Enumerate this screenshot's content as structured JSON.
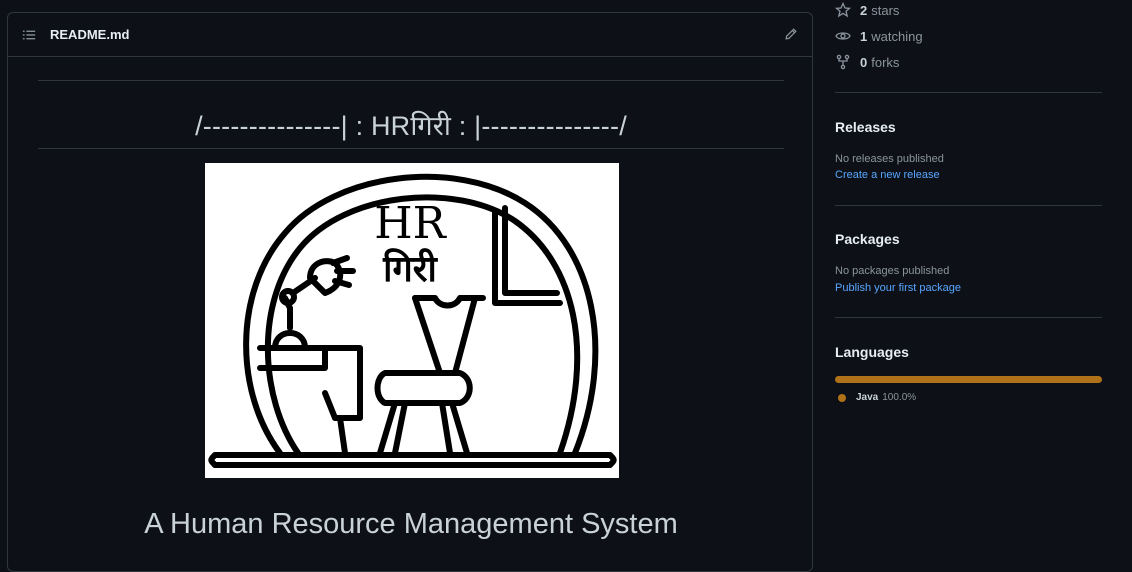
{
  "readme": {
    "filename": "README.md",
    "banner": "/---------------| : HRगिरी : |---------------/",
    "logo_text_top": "HR",
    "logo_text_bottom": "गिरी",
    "subtitle": "A Human Resource Management System"
  },
  "sidebar": {
    "stats": [
      {
        "num": "2",
        "label": "stars",
        "icon": "star-icon"
      },
      {
        "num": "1",
        "label": "watching",
        "icon": "eye-icon"
      },
      {
        "num": "0",
        "label": "forks",
        "icon": "fork-icon"
      }
    ],
    "releases": {
      "title": "Releases",
      "empty": "No releases published",
      "link": "Create a new release"
    },
    "packages": {
      "title": "Packages",
      "empty": "No packages published",
      "link": "Publish your first package"
    },
    "languages": {
      "title": "Languages",
      "items": [
        {
          "name": "Java",
          "percent": "100.0%",
          "color": "#b07219",
          "fraction": 1.0
        }
      ]
    }
  }
}
